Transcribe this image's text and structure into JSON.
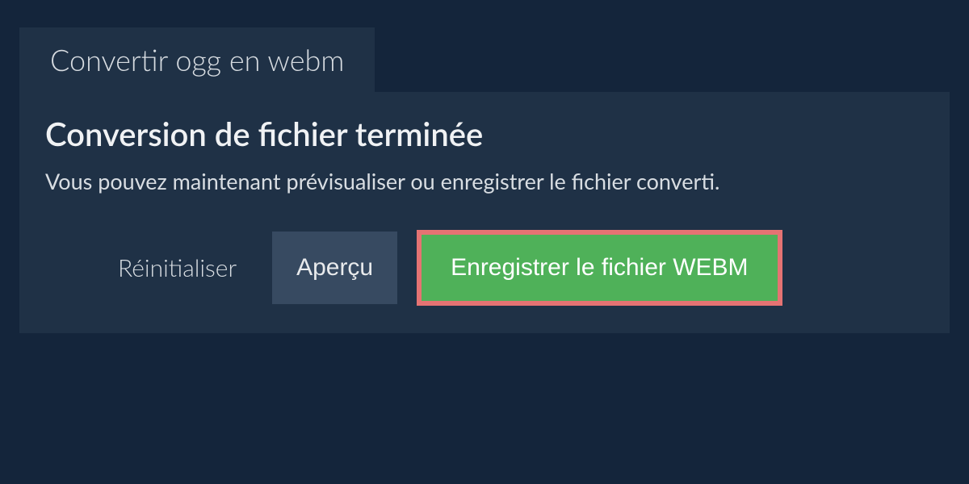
{
  "tab": {
    "title": "Convertir ogg en webm"
  },
  "panel": {
    "heading": "Conversion de fichier terminée",
    "description": "Vous pouvez maintenant prévisualiser ou enregistrer le fichier converti."
  },
  "buttons": {
    "reset": "Réinitialiser",
    "preview": "Aperçu",
    "save": "Enregistrer le fichier WEBM"
  }
}
